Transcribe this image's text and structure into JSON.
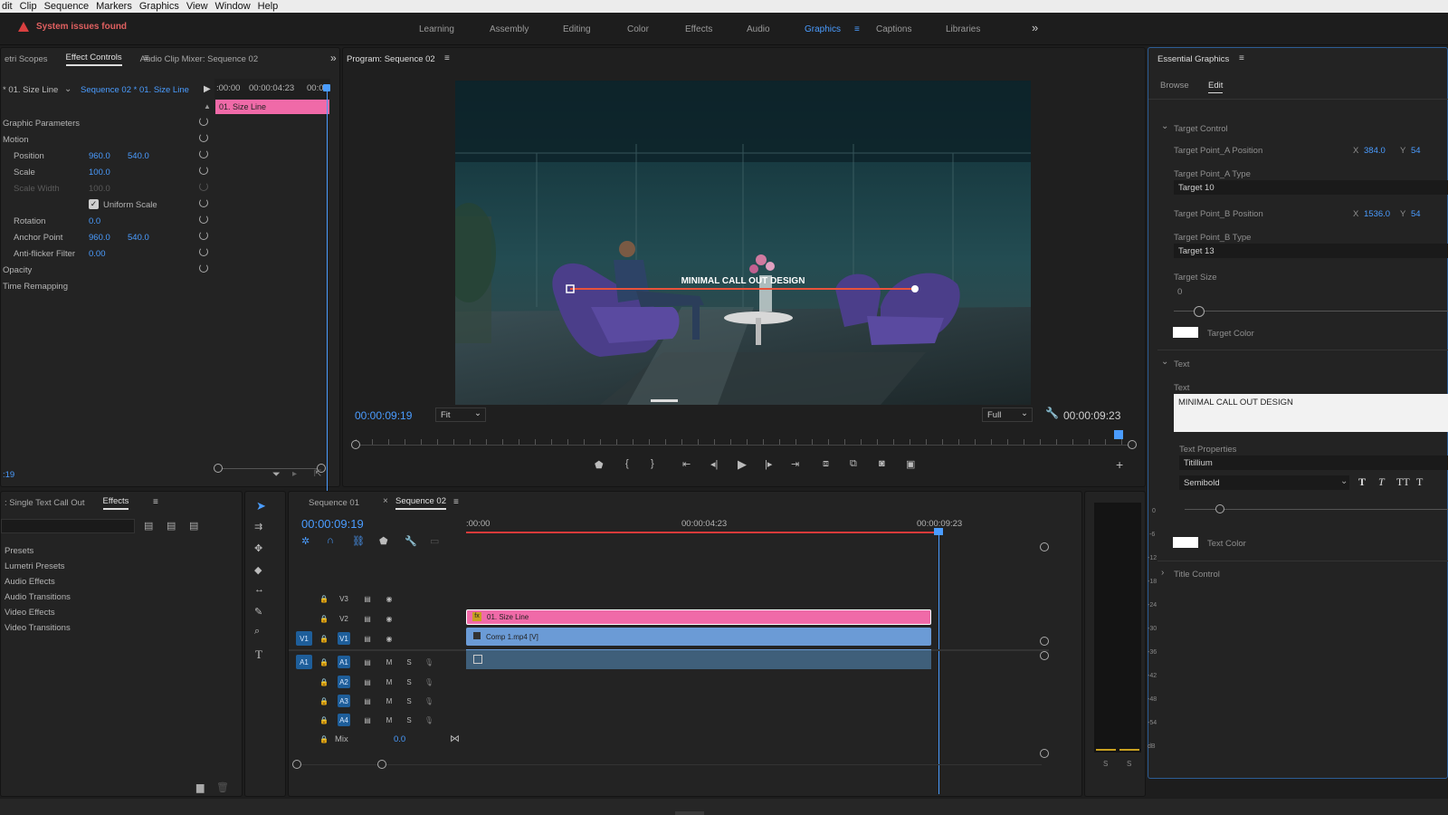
{
  "menu": [
    "dit",
    "Clip",
    "Sequence",
    "Markers",
    "Graphics",
    "View",
    "Window",
    "Help"
  ],
  "warning": "System issues found",
  "workspaces": [
    "Learning",
    "Assembly",
    "Editing",
    "Color",
    "Effects",
    "Audio",
    "Graphics",
    "Captions",
    "Libraries"
  ],
  "effect_controls": {
    "tabs": [
      "etri Scopes",
      "Effect Controls",
      "Audio Clip Mixer: Sequence 02"
    ],
    "master": "* 01. Size Line",
    "sequence": "Sequence 02 * 01. Size Line",
    "time_start": ":00:00",
    "time_mid": "00:00:04:23",
    "time_end": "00:0",
    "clip_label": "01. Size Line",
    "section_graphic": "Graphic Parameters",
    "section_motion": "Motion",
    "position_label": "Position",
    "position_x": "960.0",
    "position_y": "540.0",
    "scale_label": "Scale",
    "scale_value": "100.0",
    "scale_width_label": "Scale Width",
    "scale_width_value": "100.0",
    "uniform_scale_label": "Uniform Scale",
    "rotation_label": "Rotation",
    "rotation_value": "0.0",
    "anchor_label": "Anchor Point",
    "anchor_x": "960.0",
    "anchor_y": "540.0",
    "antiflicker_label": "Anti-flicker Filter",
    "antiflicker_value": "0.00",
    "opacity_label": "Opacity",
    "time_remap_label": "Time Remapping",
    "bottom_time": ":19"
  },
  "program": {
    "title": "Program: Sequence 02",
    "overlay_text": "MINIMAL CALL OUT DESIGN",
    "timecode": "00:00:09:19",
    "fit": "Fit",
    "quality": "Full",
    "duration": "00:00:09:23"
  },
  "essential_graphics": {
    "title": "Essential Graphics",
    "tabs": [
      "Browse",
      "Edit"
    ],
    "target_control": "Target Control",
    "tpa_pos_label": "Target Point_A Position",
    "tpa_x_label": "X",
    "tpa_x": "384.0",
    "tpa_y_label": "Y",
    "tpa_y": "54",
    "tpa_type_label": "Target Point_A Type",
    "tpa_type": "Target 10",
    "tpb_pos_label": "Target Point_B Position",
    "tpb_x_label": "X",
    "tpb_x": "1536.0",
    "tpb_y_label": "Y",
    "tpb_y": "54",
    "tpb_type_label": "Target Point_B Type",
    "tpb_type": "Target 13",
    "target_size_label": "Target Size",
    "target_size": "0",
    "target_color_label": "Target Color",
    "text_section": "Text",
    "text_label": "Text",
    "text_value": "MINIMAL CALL OUT DESIGN",
    "text_properties": "Text Properties",
    "font": "Titillium",
    "weight": "Semibold",
    "text_color_label": "Text Color",
    "title_control": "Title Control"
  },
  "effects_panel": {
    "tabs": [
      ": Single Text Call Out",
      "Effects"
    ],
    "items": [
      "Presets",
      "Lumetri Presets",
      "Audio Effects",
      "Audio Transitions",
      "Video Effects",
      "Video Transitions"
    ]
  },
  "timeline": {
    "tabs": [
      "Sequence 01",
      "Sequence 02"
    ],
    "timecode": "00:00:09:19",
    "ruler": [
      ":00:00",
      "00:00:04:23",
      "00:00:09:23"
    ],
    "tracks_v": [
      "V3",
      "V2",
      "V1"
    ],
    "tracks_a": [
      "A1",
      "A2",
      "A3",
      "A4"
    ],
    "mix_label": "Mix",
    "mix_value": "0.0",
    "clip_graphic": "01. Size Line",
    "clip_video": "Comp 1.mp4 [V]",
    "m": "M",
    "s": "S",
    "v1_src": "V1",
    "a1_src": "A1"
  },
  "vu": {
    "ticks": [
      "0",
      "-6",
      "-12",
      "-18",
      "-24",
      "-30",
      "-36",
      "-42",
      "-48",
      "-54",
      "dB"
    ],
    "s": "S"
  },
  "colors": {
    "accent": "#4a9cff",
    "graphic_clip": "#f06aa8",
    "video_clip": "#6b9bd6",
    "warning": "#d94040"
  }
}
